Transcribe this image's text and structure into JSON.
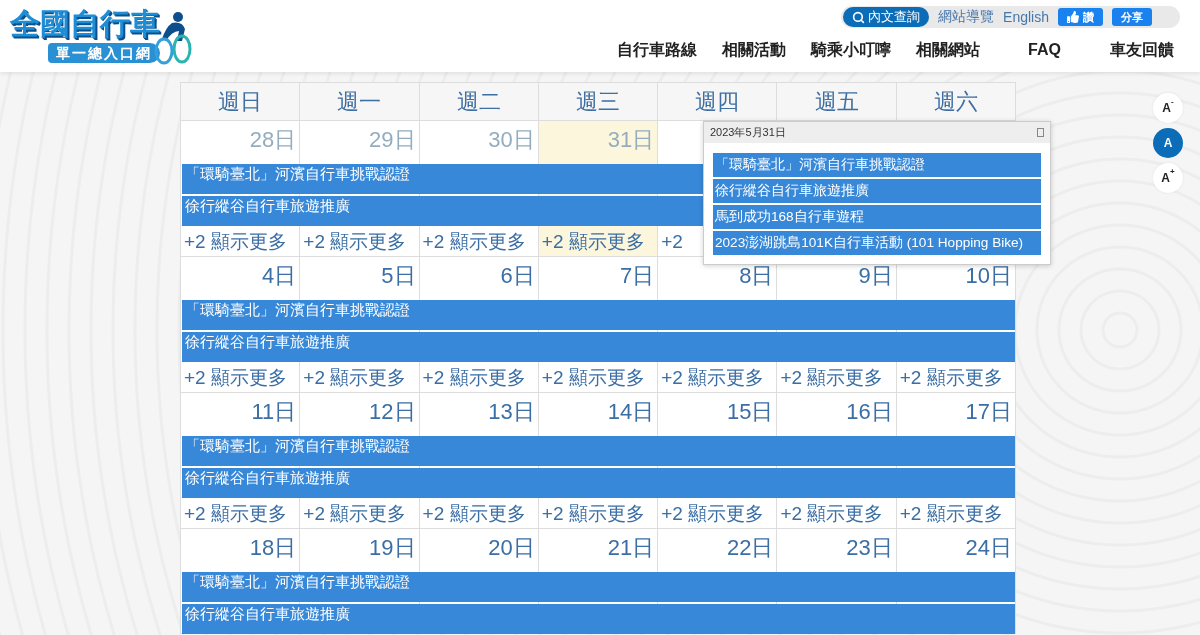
{
  "header": {
    "logo": {
      "title": "全國自行車",
      "subtitle": "單一總入口網"
    },
    "utility": {
      "search_button": "內文查詢",
      "links": [
        "網站導覽",
        "English"
      ],
      "like_button": "讚",
      "share_button": "分享"
    },
    "nav": [
      "自行車路線",
      "相關活動",
      "騎乘小叮嚀",
      "相關網站",
      "FAQ",
      "車友回饋"
    ]
  },
  "calendar": {
    "weekdays": [
      "週日",
      "週一",
      "週二",
      "週三",
      "週四",
      "週五",
      "週六"
    ],
    "weeks": [
      {
        "days": [
          {
            "label": "28日",
            "other_month": true,
            "today": false,
            "more": "+2 顯示更多"
          },
          {
            "label": "29日",
            "other_month": true,
            "today": false,
            "more": "+2 顯示更多"
          },
          {
            "label": "30日",
            "other_month": true,
            "today": false,
            "more": "+2 顯示更多"
          },
          {
            "label": "31日",
            "other_month": true,
            "today": true,
            "more": "+2 顯示更多"
          },
          {
            "today": false,
            "more": "+2"
          }
        ],
        "events": [
          {
            "title": "「環騎臺北」河濱自行車挑戰認證"
          },
          {
            "title": "徐行縱谷自行車旅遊推廣"
          }
        ]
      },
      {
        "days": [
          {
            "label": "4日",
            "other_month": false,
            "today": false,
            "more": "+2 顯示更多"
          },
          {
            "label": "5日",
            "other_month": false,
            "today": false,
            "more": "+2 顯示更多"
          },
          {
            "label": "6日",
            "other_month": false,
            "today": false,
            "more": "+2 顯示更多"
          },
          {
            "label": "7日",
            "other_month": false,
            "today": false,
            "more": "+2 顯示更多"
          },
          {
            "label": "8日",
            "other_month": false,
            "today": false,
            "more": "+2 顯示更多"
          },
          {
            "label": "9日",
            "other_month": false,
            "today": false,
            "more": "+2 顯示更多"
          },
          {
            "label": "10日",
            "other_month": false,
            "today": false,
            "more": "+2 顯示更多"
          }
        ],
        "events": [
          {
            "title": "「環騎臺北」河濱自行車挑戰認證"
          },
          {
            "title": "徐行縱谷自行車旅遊推廣"
          }
        ]
      },
      {
        "days": [
          {
            "label": "11日",
            "other_month": false,
            "today": false,
            "more": "+2 顯示更多"
          },
          {
            "label": "12日",
            "other_month": false,
            "today": false,
            "more": "+2 顯示更多"
          },
          {
            "label": "13日",
            "other_month": false,
            "today": false,
            "more": "+2 顯示更多"
          },
          {
            "label": "14日",
            "other_month": false,
            "today": false,
            "more": "+2 顯示更多"
          },
          {
            "label": "15日",
            "other_month": false,
            "today": false,
            "more": "+2 顯示更多"
          },
          {
            "label": "16日",
            "other_month": false,
            "today": false,
            "more": "+2 顯示更多"
          },
          {
            "label": "17日",
            "other_month": false,
            "today": false,
            "more": "+2 顯示更多"
          }
        ],
        "events": [
          {
            "title": "「環騎臺北」河濱自行車挑戰認證"
          },
          {
            "title": "徐行縱谷自行車旅遊推廣"
          }
        ]
      },
      {
        "days": [
          {
            "label": "18日",
            "other_month": false,
            "today": false
          },
          {
            "label": "19日",
            "other_month": false,
            "today": false
          },
          {
            "label": "20日",
            "other_month": false,
            "today": false
          },
          {
            "label": "21日",
            "other_month": false,
            "today": false
          },
          {
            "label": "22日",
            "other_month": false,
            "today": false
          },
          {
            "label": "23日",
            "other_month": false,
            "today": false
          },
          {
            "label": "24日",
            "other_month": false,
            "today": false
          }
        ],
        "events": [
          {
            "title": "「環騎臺北」河濱自行車挑戰認證"
          },
          {
            "title": "徐行縱谷自行車旅遊推廣"
          }
        ]
      }
    ],
    "popover": {
      "title": "2023年5月31日",
      "events": [
        {
          "title": "「環騎臺北」河濱自行車挑戰認證"
        },
        {
          "title": "徐行縱谷自行車旅遊推廣"
        },
        {
          "title": "馬到成功168自行車遊程"
        },
        {
          "title": "2023澎湖跳島101K自行車活動 (101 Hopping Bike)"
        }
      ]
    }
  },
  "font_size_controls": [
    {
      "label": "A$^{-}$",
      "selected": false
    },
    {
      "label": "A",
      "selected": true
    },
    {
      "label": "A$^{+}$",
      "selected": false
    }
  ]
}
